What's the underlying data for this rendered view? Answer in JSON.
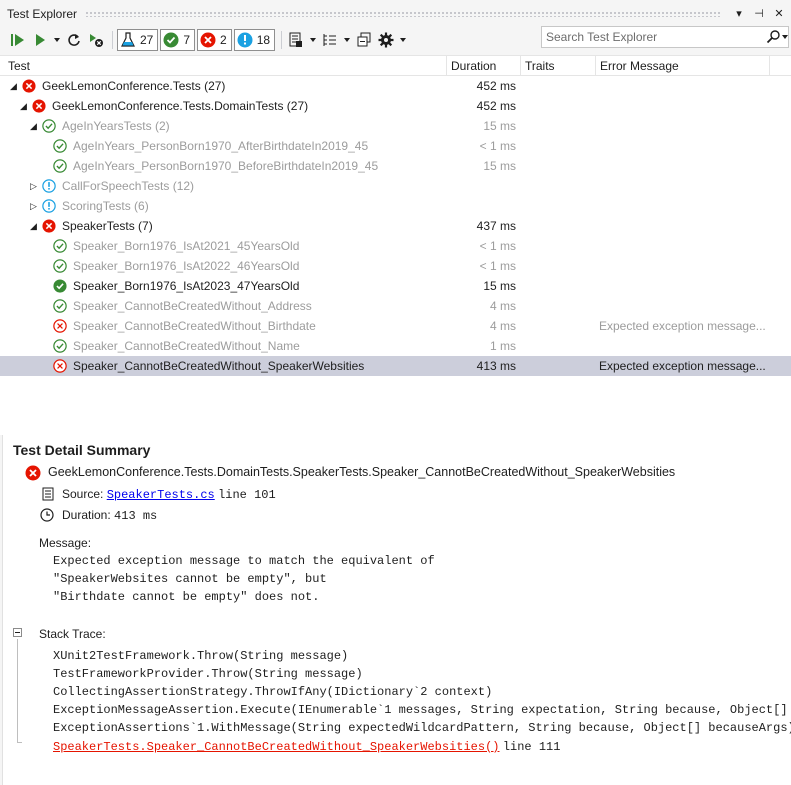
{
  "window": {
    "title": "Test Explorer",
    "buttons": [
      "▾",
      "⊣",
      "✕"
    ]
  },
  "toolbar": {
    "counters": [
      {
        "icon": "flask-icon",
        "count": "27"
      },
      {
        "icon": "passed-icon",
        "count": "7"
      },
      {
        "icon": "failed-icon",
        "count": "2"
      },
      {
        "icon": "not-run-icon",
        "count": "18"
      }
    ],
    "search_placeholder": "Search Test Explorer"
  },
  "columns": {
    "test": "Test",
    "duration": "Duration",
    "traits": "Traits",
    "error": "Error Message"
  },
  "tree": [
    {
      "label": "GeekLemonConference.Tests (27)",
      "status": "failed",
      "duration": "452 ms",
      "error": "",
      "expanded": true,
      "dim": false
    },
    {
      "label": "GeekLemonConference.Tests.DomainTests (27)",
      "status": "failed",
      "duration": "452 ms",
      "error": "",
      "expanded": true,
      "dim": false
    },
    {
      "label": "AgeInYearsTests (2)",
      "status": "passed",
      "duration": "15 ms",
      "error": "",
      "expanded": true,
      "dim": true
    },
    {
      "label": "AgeInYears_PersonBorn1970_AfterBirthdateIn2019_45",
      "status": "passed",
      "duration": "< 1 ms",
      "error": "",
      "dim": true
    },
    {
      "label": "AgeInYears_PersonBorn1970_BeforeBirthdateIn2019_45",
      "status": "passed",
      "duration": "15 ms",
      "error": "",
      "dim": true
    },
    {
      "label": "CallForSpeechTests (12)",
      "status": "not-run",
      "duration": "",
      "error": "",
      "expanded": false,
      "dim": true
    },
    {
      "label": "ScoringTests (6)",
      "status": "not-run",
      "duration": "",
      "error": "",
      "expanded": false,
      "dim": true
    },
    {
      "label": "SpeakerTests (7)",
      "status": "failed",
      "duration": "437 ms",
      "error": "",
      "expanded": true,
      "dim": false
    },
    {
      "label": "Speaker_Born1976_IsAt2021_45YearsOld",
      "status": "passed",
      "duration": "< 1 ms",
      "error": "",
      "dim": true
    },
    {
      "label": "Speaker_Born1976_IsAt2022_46YearsOld",
      "status": "passed",
      "duration": "< 1 ms",
      "error": "",
      "dim": true
    },
    {
      "label": "Speaker_Born1976_IsAt2023_47YearsOld",
      "status": "passed-solid",
      "duration": "15 ms",
      "error": "",
      "dim": false
    },
    {
      "label": "Speaker_CannotBeCreatedWithout_Address",
      "status": "passed",
      "duration": "4 ms",
      "error": "",
      "dim": true
    },
    {
      "label": "Speaker_CannotBeCreatedWithout_Birthdate",
      "status": "failed-outline",
      "duration": "4 ms",
      "error": "Expected exception message...",
      "dim": true
    },
    {
      "label": "Speaker_CannotBeCreatedWithout_Name",
      "status": "passed",
      "duration": "1 ms",
      "error": "",
      "dim": true
    },
    {
      "label": "Speaker_CannotBeCreatedWithout_SpeakerWebsities",
      "status": "failed-outline",
      "duration": "413 ms",
      "error": "Expected exception message...",
      "dim": false,
      "selected": true
    }
  ],
  "detail": {
    "heading": "Test Detail Summary",
    "test_name": "GeekLemonConference.Tests.DomainTests.SpeakerTests.Speaker_CannotBeCreatedWithout_SpeakerWebsities",
    "source_label": "Source:",
    "source_file": "SpeakerTests.cs",
    "source_line": "line 101",
    "duration_label": "Duration:",
    "duration_value": "413 ms",
    "message_label": "Message:",
    "message_lines": [
      "Expected exception message to match the equivalent of",
      "\"SpeakerWebsites cannot be empty\", but",
      "\"Birthdate cannot be empty\" does not."
    ],
    "stack_label": "Stack Trace:",
    "stack_lines": [
      "XUnit2TestFramework.Throw(String message)",
      "TestFrameworkProvider.Throw(String message)",
      "CollectingAssertionStrategy.ThrowIfAny(IDictionary`2 context)",
      "ExceptionMessageAssertion.Execute(IEnumerable`1 messages, String expectation, String because, Object[] be",
      "ExceptionAssertions`1.WithMessage(String expectedWildcardPattern, String because, Object[] becauseArgs)"
    ],
    "stack_link": "SpeakerTests.Speaker_CannotBeCreatedWithout_SpeakerWebsities()",
    "stack_link_line": "line 111"
  },
  "colors": {
    "failed": "#e51400",
    "passed": "#388a34",
    "not_run": "#1ba1e2",
    "selected_row": "#cccedb",
    "link": "#0000ee"
  }
}
